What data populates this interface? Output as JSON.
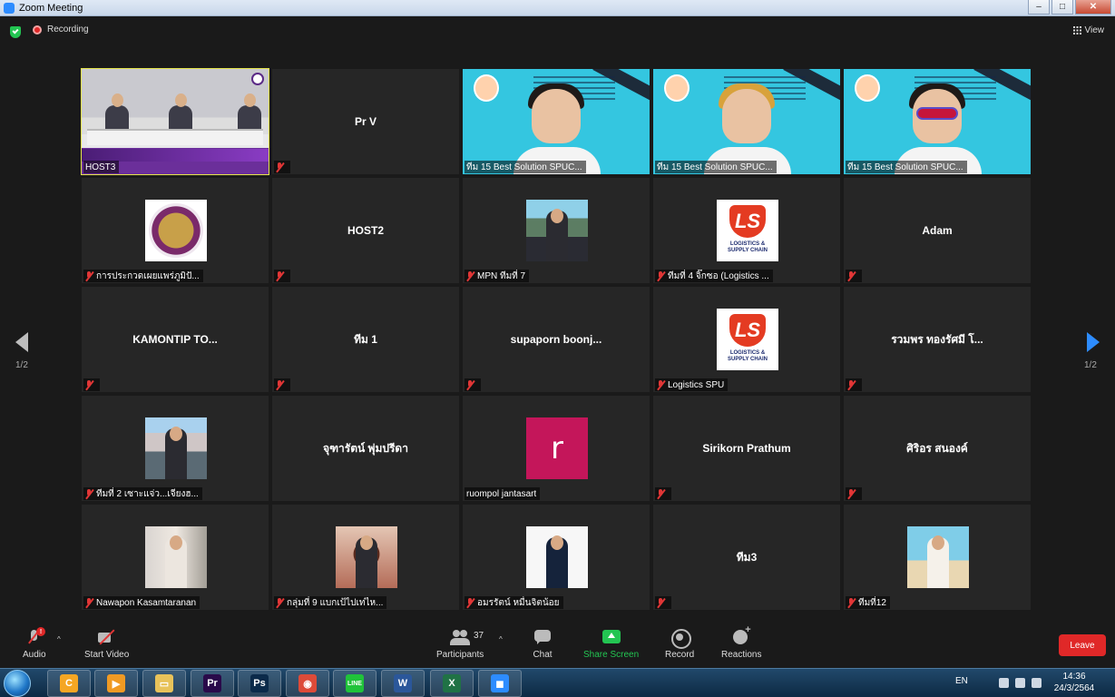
{
  "window": {
    "title": "Zoom Meeting"
  },
  "topbar": {
    "recording_label": "Recording",
    "view_label": "View"
  },
  "gallery": {
    "tiles": [
      {
        "name": "",
        "caption": "HOST3",
        "kind": "host-video",
        "muted": false,
        "active": true
      },
      {
        "name": "Pr V",
        "caption": "",
        "kind": "name",
        "muted": true
      },
      {
        "name": "",
        "caption": "ทีม 15 Best Solution SPUC...",
        "kind": "video-1",
        "muted": false
      },
      {
        "name": "",
        "caption": "ทีม 15 Best Solution SPUC...",
        "kind": "video-2",
        "muted": false
      },
      {
        "name": "",
        "caption": "ทีม 15 Best Solution SPUC...",
        "kind": "video-3",
        "muted": false
      },
      {
        "name": "",
        "caption": "การประกวดเผยแพร่ภูมิปั...",
        "kind": "seal",
        "muted": true
      },
      {
        "name": "HOST2",
        "caption": "",
        "kind": "name",
        "muted": true
      },
      {
        "name": "",
        "caption": "MPN ทีมที่ 7",
        "kind": "photo-a",
        "muted": true
      },
      {
        "name": "",
        "caption": "ทีมที่ 4 จิ๊กซอ (Logistics ...",
        "kind": "logo-ls",
        "muted": true
      },
      {
        "name": "Adam",
        "caption": "",
        "kind": "name",
        "muted": true
      },
      {
        "name": "KAMONTIP  TO...",
        "caption": "",
        "kind": "name",
        "muted": true
      },
      {
        "name": "ทีม 1",
        "caption": "",
        "kind": "name",
        "muted": true
      },
      {
        "name": "supaporn  boonj...",
        "caption": "",
        "kind": "name",
        "muted": true
      },
      {
        "name": "",
        "caption": "Logistics SPU",
        "kind": "logo-ls",
        "muted": true
      },
      {
        "name": "รวมพร ทองรัศมี โ...",
        "caption": "",
        "kind": "name",
        "muted": true
      },
      {
        "name": "",
        "caption": "ทีมที่ 2 เซาะแจ่ว...เจียงฮ...",
        "kind": "photo-b",
        "muted": true
      },
      {
        "name": "จุฑารัตน์ พุ่มปรีดา",
        "caption": "",
        "kind": "name",
        "muted": false
      },
      {
        "name": "",
        "caption": "ruompol jantasart",
        "kind": "letter",
        "letter": "r",
        "muted": false
      },
      {
        "name": "Sirikorn Prathum",
        "caption": "",
        "kind": "name",
        "muted": true
      },
      {
        "name": "ศิริอร สนองค์",
        "caption": "",
        "kind": "name",
        "muted": true
      },
      {
        "name": "",
        "caption": "Nawapon Kasamtaranan",
        "kind": "photo-c",
        "muted": true
      },
      {
        "name": "",
        "caption": "กลุ่มที่ 9 แบกเป้ไปเท่ไห...",
        "kind": "photo-d",
        "muted": true
      },
      {
        "name": "",
        "caption": "อมรรัตน์  หมื่นจิตน้อย",
        "kind": "photo-e",
        "muted": true
      },
      {
        "name": "ทีม3",
        "caption": "",
        "kind": "name",
        "muted": true
      },
      {
        "name": "",
        "caption": "ทีมที่12",
        "kind": "photo-f",
        "muted": true
      }
    ]
  },
  "logo_text": {
    "line1": "LOGISTICS &",
    "line2": "SUPPLY CHAIN"
  },
  "pagination": {
    "left": "1/2",
    "right": "1/2"
  },
  "toolbar": {
    "audio_label": "Audio",
    "audio_alert": "!",
    "video_label": "Start Video",
    "participants_label": "Participants",
    "participants_count": "37",
    "chat_label": "Chat",
    "share_label": "Share Screen",
    "record_label": "Record",
    "reactions_label": "Reactions",
    "leave_label": "Leave"
  },
  "taskbar": {
    "apps": [
      {
        "name": "ccleaner",
        "glyph": "C",
        "color": "#f5a623"
      },
      {
        "name": "media-player",
        "glyph": "▶",
        "color": "#f09a23"
      },
      {
        "name": "file-explorer",
        "glyph": "▭",
        "color": "#e8c25a"
      },
      {
        "name": "premiere",
        "glyph": "Pr",
        "color": "#2a0a4a"
      },
      {
        "name": "photoshop",
        "glyph": "Ps",
        "color": "#0b2a4a"
      },
      {
        "name": "chrome",
        "glyph": "◉",
        "color": "#dd4b39"
      },
      {
        "name": "line",
        "glyph": "LINE",
        "color": "#20c33a"
      },
      {
        "name": "word",
        "glyph": "W",
        "color": "#2b579a"
      },
      {
        "name": "excel",
        "glyph": "X",
        "color": "#207245"
      },
      {
        "name": "zoom",
        "glyph": "◼",
        "color": "#2d8cff"
      }
    ],
    "language": "EN",
    "time": "14:36",
    "date": "24/3/2564"
  },
  "colors": {
    "accent": "#2d8cff",
    "leave": "#e02828",
    "share": "#23c552",
    "active_outline": "#e3e34a"
  }
}
